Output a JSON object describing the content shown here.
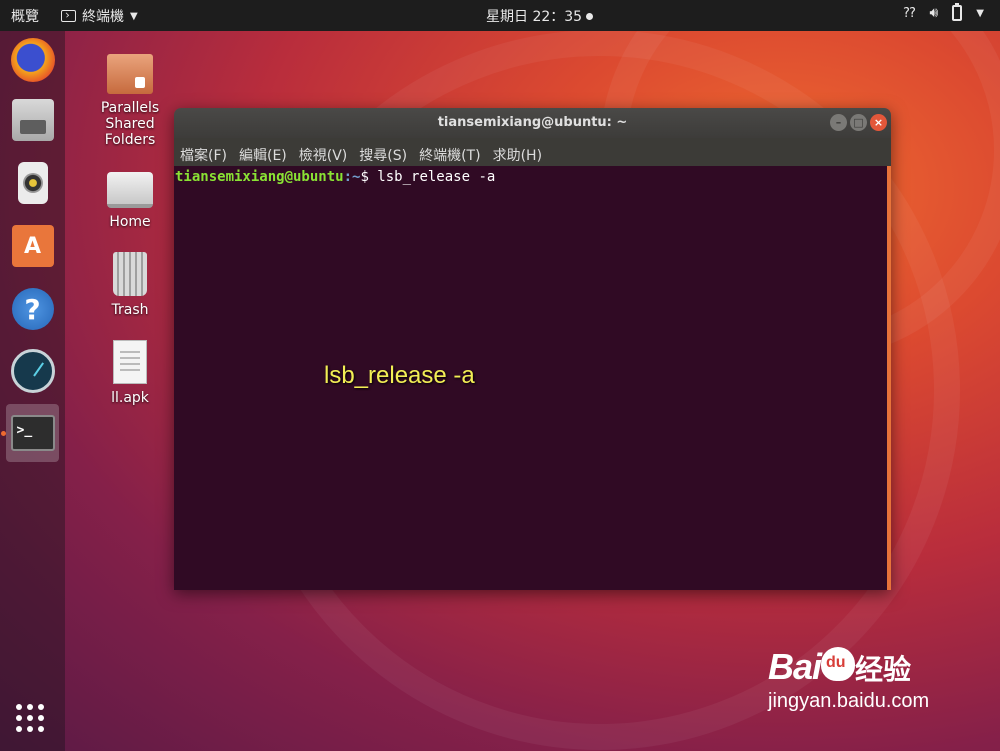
{
  "topbar": {
    "activities": "概覽",
    "app_menu": "終端機",
    "clock": "星期日 22：35"
  },
  "dock": {
    "items": [
      {
        "name": "firefox"
      },
      {
        "name": "files"
      },
      {
        "name": "rhythmbox"
      },
      {
        "name": "ubuntu-software",
        "glyph": "A"
      },
      {
        "name": "help",
        "glyph": "?"
      },
      {
        "name": "stacer"
      },
      {
        "name": "terminal",
        "glyph": ">_",
        "active": true
      }
    ]
  },
  "desktop": {
    "icons": [
      {
        "label": "Parallels Shared Folders"
      },
      {
        "label": "Home"
      },
      {
        "label": "Trash"
      },
      {
        "label": "ll.apk"
      }
    ]
  },
  "terminal": {
    "title": "tiansemixiang@ubuntu: ~",
    "menu": [
      "檔案(F)",
      "編輯(E)",
      "檢視(V)",
      "搜尋(S)",
      "終端機(T)",
      "求助(H)"
    ],
    "prompt_user": "tiansemixiang@ubuntu",
    "prompt_path": ":~",
    "prompt_symbol": "$ ",
    "command": "lsb_release -a",
    "overlay_caption": "lsb_release -a"
  },
  "watermark": {
    "brand": "Bai",
    "brand_cn": "经验",
    "url": "jingyan.baidu.com"
  },
  "colors": {
    "prompt_user": "#8ae234",
    "prompt_path": "#729fcf",
    "terminal_bg": "#300a24",
    "accent": "#e8733a"
  }
}
